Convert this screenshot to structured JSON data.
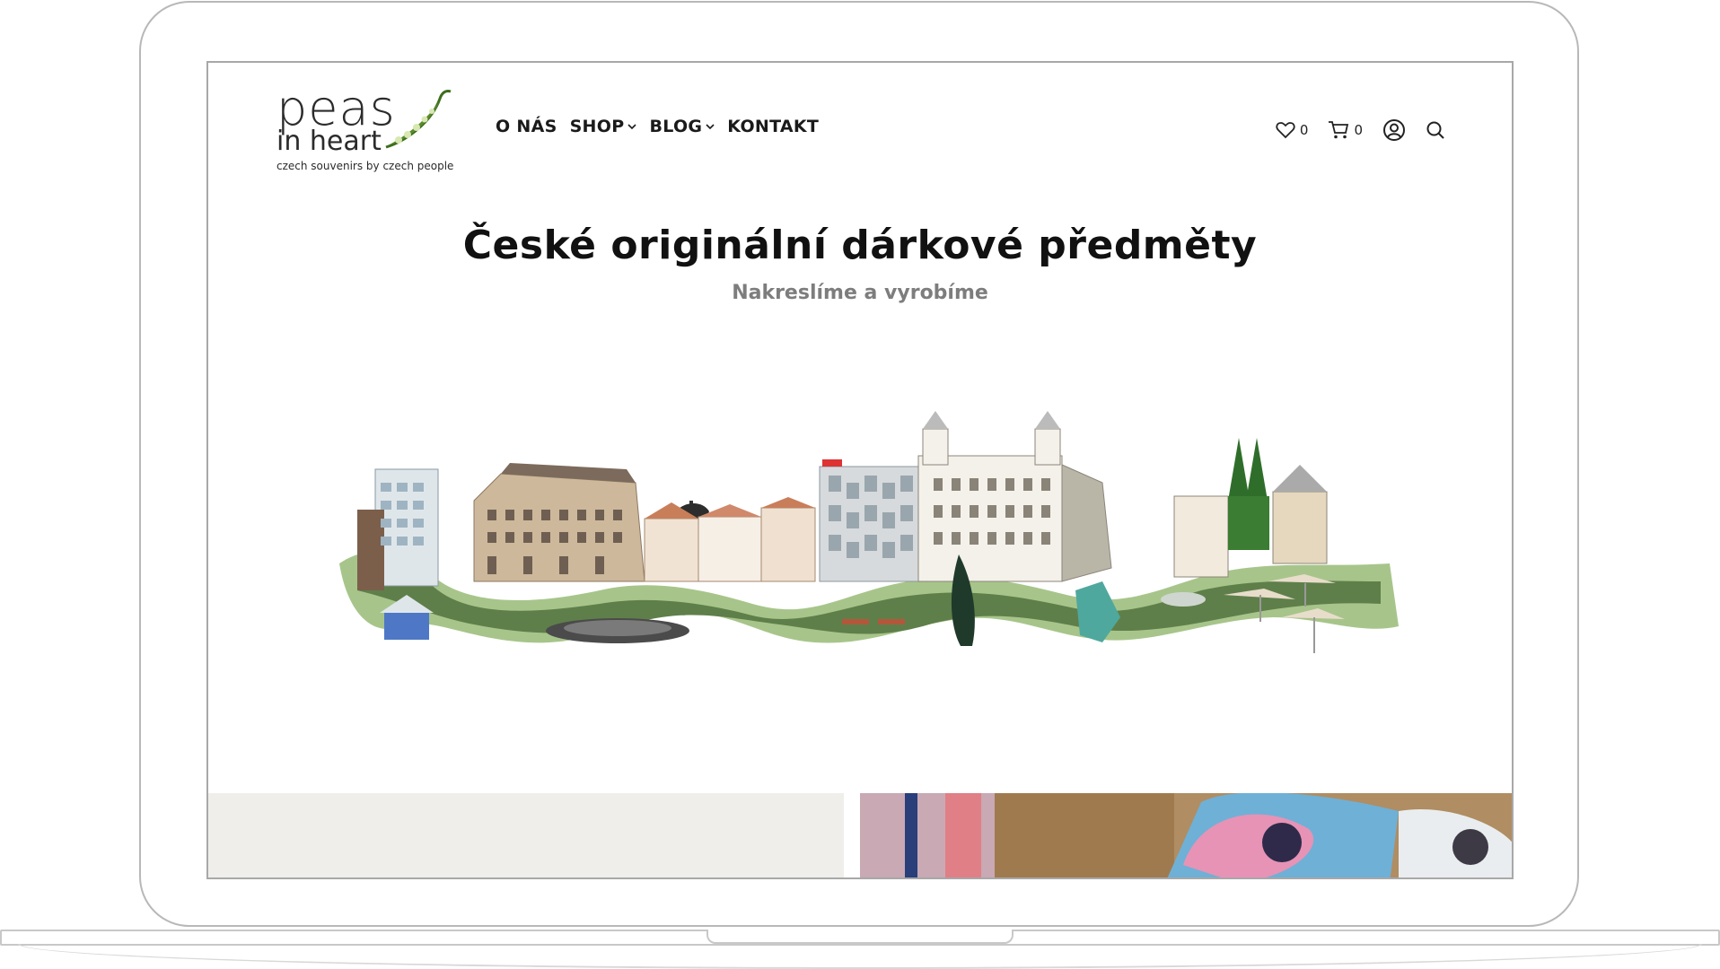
{
  "logo": {
    "word1": "peas",
    "word2": "in heart",
    "tagline": "czech souvenirs by czech people"
  },
  "nav": {
    "items": [
      {
        "label": "O NÁS",
        "has_dropdown": false
      },
      {
        "label": "SHOP",
        "has_dropdown": true
      },
      {
        "label": "BLOG",
        "has_dropdown": true
      },
      {
        "label": "KONTAKT",
        "has_dropdown": false
      }
    ]
  },
  "tools": {
    "wishlist_count": "0",
    "cart_count": "0",
    "icons": [
      "heart-icon",
      "cart-icon",
      "account-icon",
      "search-icon"
    ]
  },
  "hero": {
    "title": "České originální dárkové předměty",
    "subtitle": "Nakreslíme a vyrobíme"
  },
  "colors": {
    "accent_green": "#5a8a2e",
    "grass": "#a7c58a",
    "text": "#111111",
    "subtitle": "#7d7d7d"
  }
}
